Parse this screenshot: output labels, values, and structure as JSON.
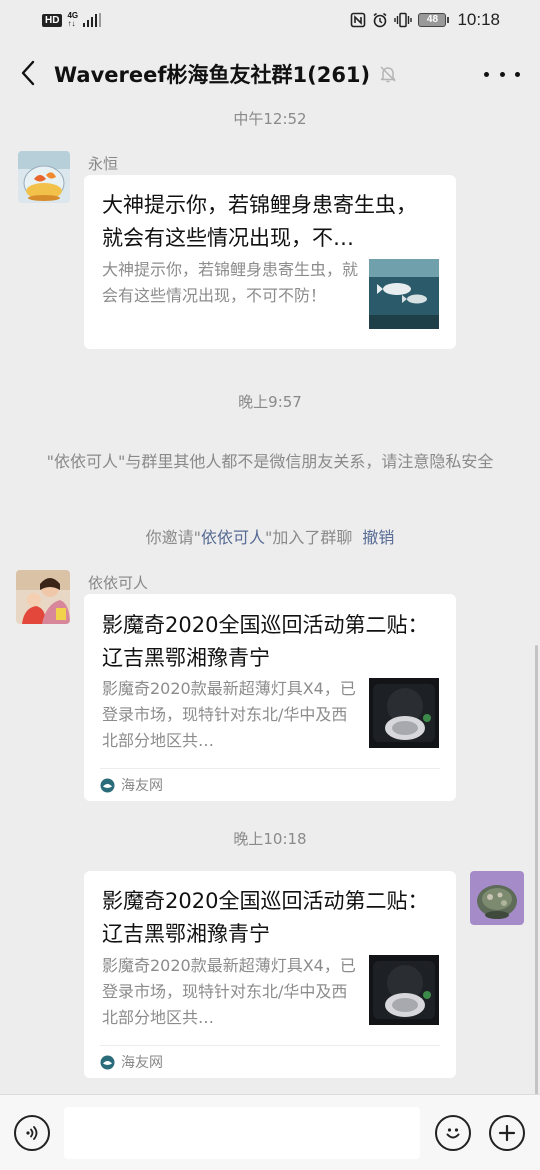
{
  "status_bar": {
    "hd": "HD",
    "net_top": "4G",
    "net_bottom": "↑↓",
    "battery": "48",
    "time": "10:18"
  },
  "nav": {
    "title": "Wavereef彬海鱼友社群1(261)",
    "icons": [
      "back-icon",
      "mute-bell-icon",
      "more-icon"
    ]
  },
  "messages": {
    "time1": "中午12:52",
    "msg1": {
      "sender": "永恒",
      "title": "大神提示你，若锦鲤身患寄生虫，就会有这些情况出现，不…",
      "desc": "大神提示你，若锦鲤身患寄生虫，就会有这些情况出现，不可不防！"
    },
    "time2": "晚上9:57",
    "sys_notice": "\"依依可人\"与群里其他人都不是微信朋友关系，请注意隐私安全",
    "invite": {
      "prefix": "你邀请\"",
      "name": "依依可人",
      "suffix": "\"加入了群聊",
      "undo": "撤销"
    },
    "msg2": {
      "sender": "依依可人",
      "title": "影魔奇2020全国巡回活动第二贴： 辽吉黑鄂湘豫青宁",
      "desc": "影魔奇2020款最新超薄灯具X4，已登录市场，现特针对东北/华中及西北部分地区共…",
      "source": "海友网"
    },
    "time3": "晚上10:18",
    "msg3": {
      "title": "影魔奇2020全国巡回活动第二贴： 辽吉黑鄂湘豫青宁",
      "desc": "影魔奇2020款最新超薄灯具X4，已登录市场，现特针对东北/华中及西北部分地区共…",
      "source": "海友网"
    }
  },
  "input_bar": {
    "icons": [
      "voice-icon",
      "emoji-icon",
      "plus-icon"
    ],
    "text": ""
  }
}
